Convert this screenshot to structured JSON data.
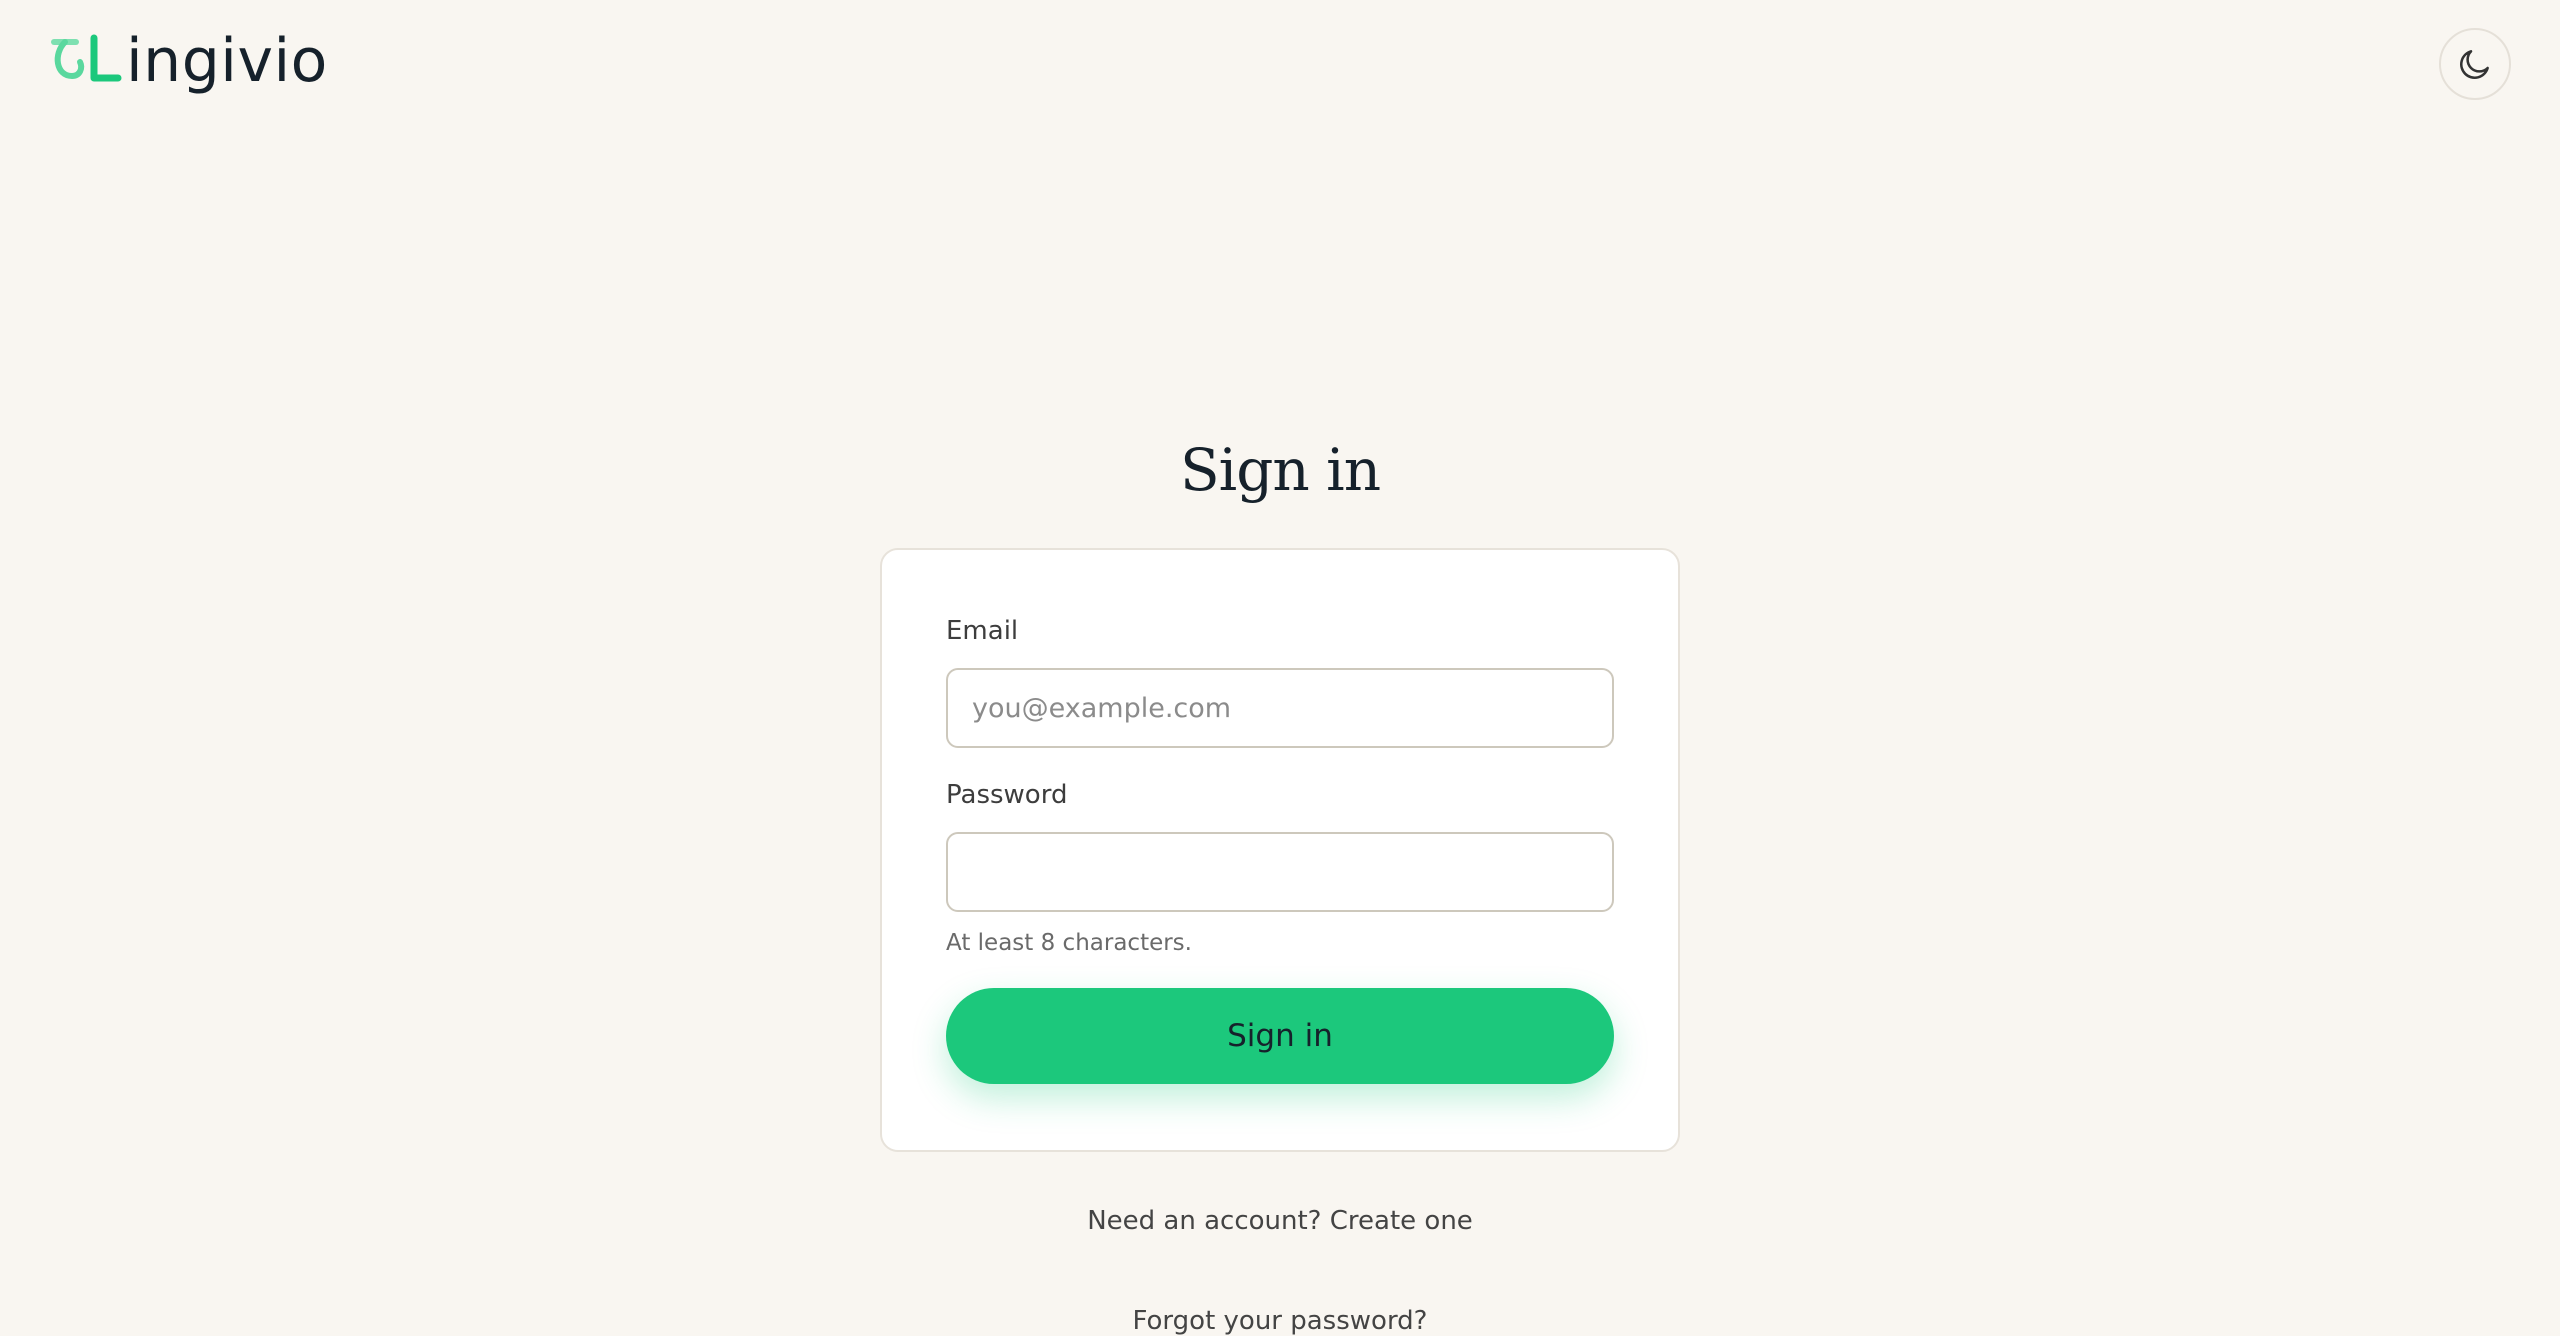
{
  "header": {
    "logo_text": "ingivio",
    "logo_alt": "Lingivio",
    "theme_toggle_icon": "moon-icon"
  },
  "main": {
    "title": "Sign in",
    "form": {
      "email_label": "Email",
      "email_placeholder": "you@example.com",
      "email_value": "",
      "password_label": "Password",
      "password_value": "",
      "password_hint": "At least 8 characters.",
      "submit_label": "Sign in"
    },
    "account_prompt": "Need an account?",
    "create_link": "Create one",
    "forgot_link": "Forgot your password?"
  },
  "colors": {
    "background": "#f9f6f1",
    "accent": "#1cc87c",
    "text_dark": "#16212b"
  }
}
